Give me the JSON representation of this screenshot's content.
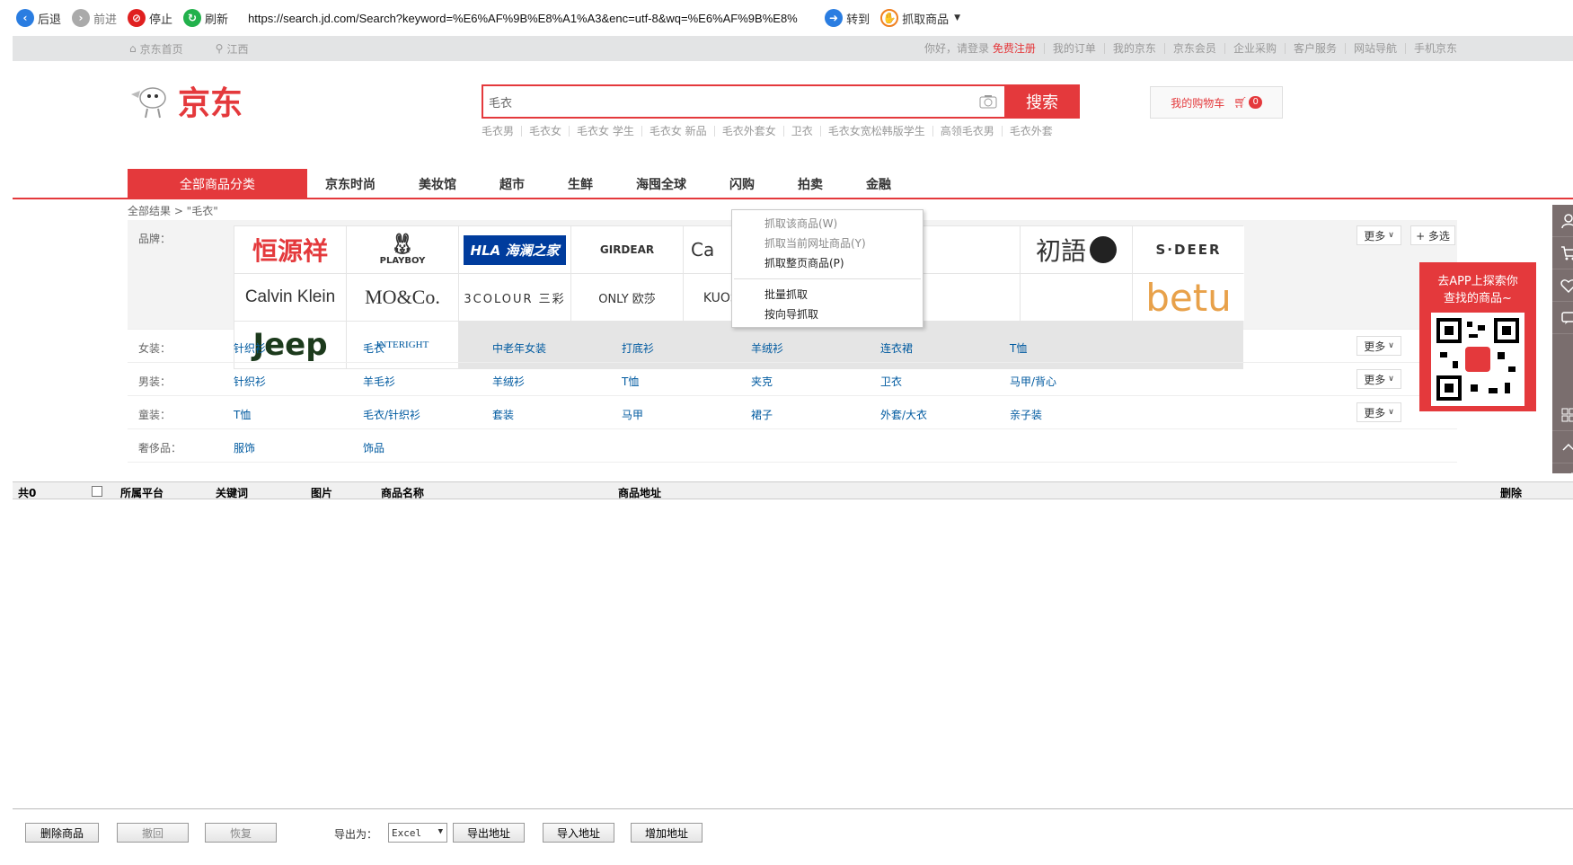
{
  "toolbar": {
    "back": "后退",
    "forward": "前进",
    "stop": "停止",
    "refresh": "刷新",
    "url": "https://search.jd.com/Search?keyword=%E6%AF%9B%E8%A1%A3&enc=utf-8&wq=%E6%AF%9B%E8%",
    "goto": "转到",
    "grab": "抓取商品"
  },
  "topbar": {
    "home": "京东首页",
    "location": "江西",
    "greeting": "你好，请登录",
    "register": "免费注册",
    "links": [
      "我的订单",
      "我的京东",
      "京东会员",
      "企业采购",
      "客户服务",
      "网站导航",
      "手机京东"
    ]
  },
  "header": {
    "logo": "京东",
    "search_value": "毛衣",
    "search_button": "搜索",
    "hotwords": [
      "毛衣男",
      "毛衣女",
      "毛衣女 学生",
      "毛衣女 新品",
      "毛衣外套女",
      "卫衣",
      "毛衣女宽松韩版学生",
      "高领毛衣男",
      "毛衣外套"
    ],
    "cart": "我的购物车",
    "cart_count": "0"
  },
  "nav": {
    "all": "全部商品分类",
    "items": [
      "京东时尚",
      "美妆馆",
      "超市",
      "生鲜",
      "海囤全球",
      "闪购",
      "拍卖",
      "金融"
    ]
  },
  "crumb": "全部结果 > \"毛衣\"",
  "filter": {
    "brand_label": "品牌：",
    "brands_row1": [
      "恒源祥",
      "PLAYBOY",
      "HLA 海澜之家",
      "GIRDEAR",
      "Ca",
      "",
      "",
      "初語",
      "S·DEER",
      "Calvin Klein"
    ],
    "brands_row2": [
      "MO&Co.",
      "3COLOUR 三彩",
      "ONLY 欧莎",
      "KUOSE 阔色",
      "",
      "",
      "",
      "betu",
      "Jeep",
      "INTERIGHT"
    ],
    "more": "更多",
    "multi": "+ 多选",
    "rows": [
      {
        "label": "女装：",
        "items": [
          "针织衫",
          "毛衣",
          "中老年女装",
          "打底衫",
          "羊绒衫",
          "连衣裙",
          "T恤"
        ]
      },
      {
        "label": "男装：",
        "items": [
          "针织衫",
          "羊毛衫",
          "羊绒衫",
          "T恤",
          "夹克",
          "卫衣",
          "马甲/背心"
        ]
      },
      {
        "label": "童装：",
        "items": [
          "T恤",
          "毛衣/针织衫",
          "套装",
          "马甲",
          "裙子",
          "外套/大衣",
          "亲子装"
        ]
      },
      {
        "label": "奢侈品：",
        "items": [
          "服饰",
          "饰品"
        ]
      }
    ]
  },
  "context_menu": {
    "items": [
      "抓取该商品(W)",
      "抓取当前网址商品(Y)",
      "抓取整页商品(P)",
      "批量抓取",
      "按向导抓取"
    ]
  },
  "app_promo": {
    "line1": "去APP上探索你",
    "line2": "查找的商品~",
    "badge": "京东"
  },
  "grid": {
    "count": "共0",
    "columns": [
      "所属平台",
      "关键词",
      "图片",
      "商品名称",
      "商品地址",
      "删除"
    ]
  },
  "bottom": {
    "delete": "删除商品",
    "undo": "撤回",
    "restore": "恢复",
    "export_label": "导出为：",
    "export_value": "Excel",
    "export_addr": "导出地址",
    "import_addr": "导入地址",
    "add_addr": "增加地址"
  },
  "colors": {
    "jd_red": "#e4393c",
    "link_blue": "#005aa0"
  }
}
